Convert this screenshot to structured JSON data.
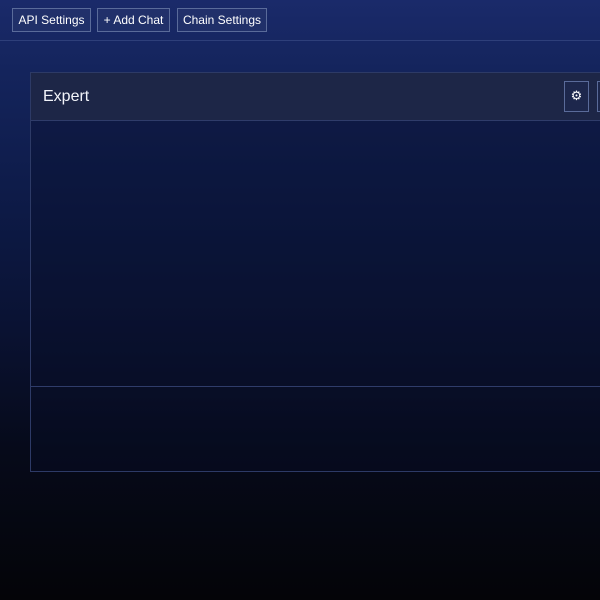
{
  "toolbar": {
    "api_settings_label": "API Settings",
    "add_chat_label": "+ Add Chat",
    "chain_settings_label": "Chain Settings"
  },
  "chat_panel": {
    "title": "Expert",
    "settings_icon": "gear-icon",
    "settings_glyph": "⚙"
  }
}
